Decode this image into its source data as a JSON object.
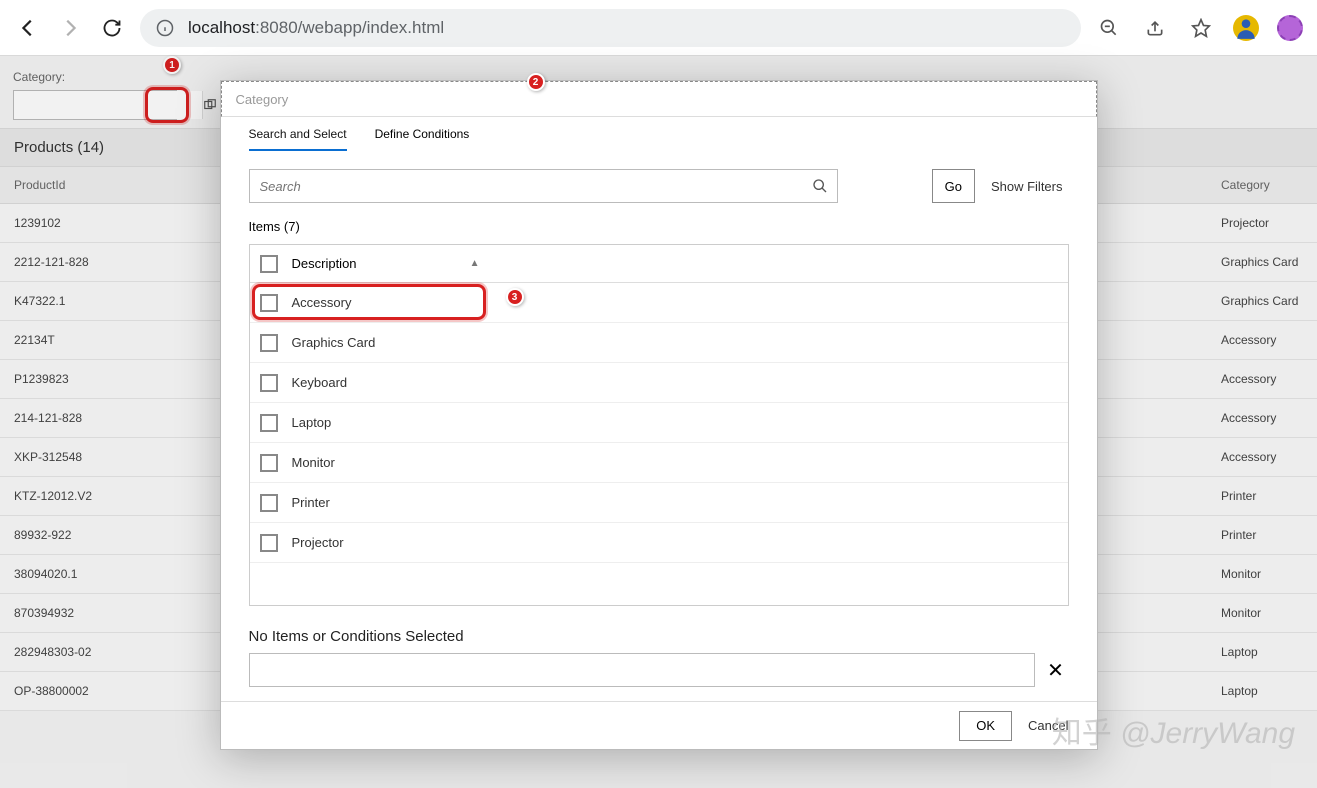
{
  "browser": {
    "url_prefix": "localhost",
    "url_rest": ":8080/webapp/index.html"
  },
  "filter": {
    "label": "Category:"
  },
  "products_header": "Products (14)",
  "table": {
    "col_productid": "ProductId",
    "col_category": "Category",
    "rows": [
      {
        "id": "1239102",
        "cat": "Projector"
      },
      {
        "id": "2212-121-828",
        "cat": "Graphics Card"
      },
      {
        "id": "K47322.1",
        "cat": "Graphics Card"
      },
      {
        "id": "22134T",
        "cat": "Accessory"
      },
      {
        "id": "P1239823",
        "cat": "Accessory"
      },
      {
        "id": "214-121-828",
        "cat": "Accessory"
      },
      {
        "id": "XKP-312548",
        "cat": "Accessory"
      },
      {
        "id": "KTZ-12012.V2",
        "cat": "Printer"
      },
      {
        "id": "89932-922",
        "cat": "Printer"
      },
      {
        "id": "38094020.1",
        "cat": "Monitor"
      },
      {
        "id": "870394932",
        "cat": "Monitor"
      },
      {
        "id": "282948303-02",
        "cat": "Laptop"
      },
      {
        "id": "OP-38800002",
        "cat": "Laptop"
      }
    ]
  },
  "dialog": {
    "title": "Category",
    "tab_search": "Search and Select",
    "tab_define": "Define Conditions",
    "search_placeholder": "Search",
    "go": "Go",
    "show_filters": "Show Filters",
    "items_label": "Items (7)",
    "col_description": "Description",
    "items": [
      "Accessory",
      "Graphics Card",
      "Keyboard",
      "Laptop",
      "Monitor",
      "Printer",
      "Projector"
    ],
    "selected_label": "No Items or Conditions Selected",
    "ok": "OK",
    "cancel": "Cancel"
  },
  "annotations": {
    "step1": "1",
    "step2": "2",
    "step3": "3"
  },
  "watermark": "知乎 @JerryWang"
}
